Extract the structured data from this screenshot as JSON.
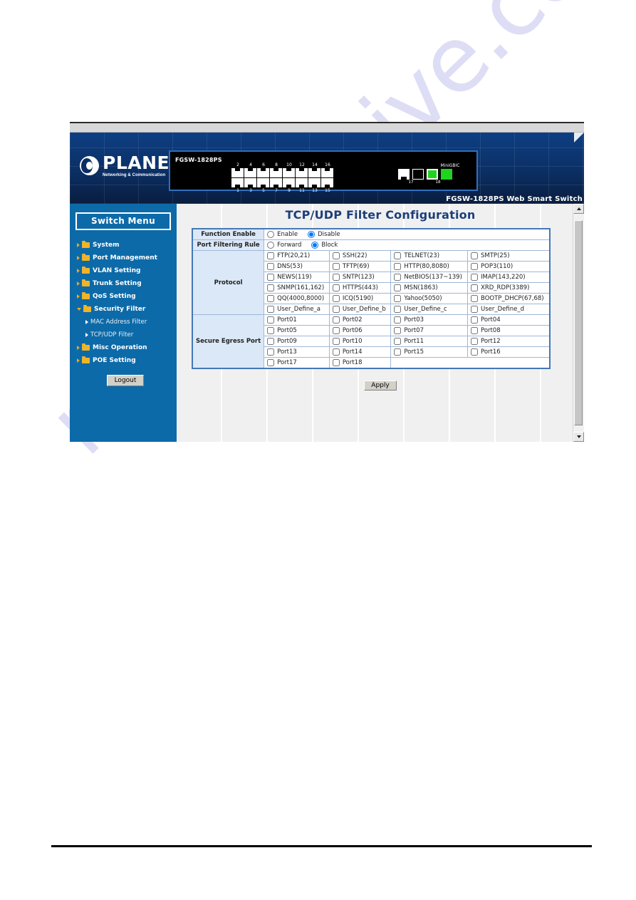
{
  "watermark": {
    "text": "manualshive.com"
  },
  "banner": {
    "brand_name": "PLANET",
    "brand_tagline": "Networking & Communication",
    "device_model": "FGSW-1828PS",
    "device_port_labels_top_group1": [
      "2",
      "4",
      "6",
      "8"
    ],
    "device_port_labels_bottom_group1": [
      "1",
      "3",
      "5",
      "7"
    ],
    "device_port_labels_top_group2": [
      "10",
      "12",
      "14",
      "16"
    ],
    "device_port_labels_bottom_group2": [
      "9",
      "11",
      "13",
      "15"
    ],
    "device_uplink_caption": "MiniGBIC",
    "device_uplink_label_17": "17",
    "device_uplink_label_18": "18",
    "title": "FGSW-1828PS Web Smart Switch"
  },
  "sidebar": {
    "title": "Switch Menu",
    "items": [
      {
        "label": "System",
        "type": "folder",
        "expanded": false
      },
      {
        "label": "Port Management",
        "type": "folder",
        "expanded": false
      },
      {
        "label": "VLAN Setting",
        "type": "folder",
        "expanded": false
      },
      {
        "label": "Trunk Setting",
        "type": "folder",
        "expanded": false
      },
      {
        "label": "QoS Setting",
        "type": "folder",
        "expanded": false
      },
      {
        "label": "Security Filter",
        "type": "folder",
        "expanded": true
      },
      {
        "label": "MAC Address Filter",
        "type": "leaf"
      },
      {
        "label": "TCP/UDP Filter",
        "type": "leaf"
      },
      {
        "label": "Misc Operation",
        "type": "folder",
        "expanded": false
      },
      {
        "label": "POE Setting",
        "type": "folder",
        "expanded": false
      }
    ],
    "logout_label": "Logout",
    "background_color": "#0d6aa8",
    "arrow_color": "#f3a712"
  },
  "main": {
    "page_title": "TCP/UDP Filter Configuration",
    "apply_label": "Apply",
    "rows": {
      "function_enable": {
        "label": "Function Enable",
        "options": [
          "Enable",
          "Disable"
        ],
        "selected": "Disable"
      },
      "port_filtering_rule": {
        "label": "Port Filtering Rule",
        "options": [
          "Forward",
          "Block"
        ],
        "selected": "Block"
      },
      "protocol": {
        "label": "Protocol",
        "grid": [
          [
            "FTP(20,21)",
            "SSH(22)",
            "TELNET(23)",
            "SMTP(25)"
          ],
          [
            "DNS(53)",
            "TFTP(69)",
            "HTTP(80,8080)",
            "POP3(110)"
          ],
          [
            "NEWS(119)",
            "SNTP(123)",
            "NetBIOS(137~139)",
            "IMAP(143,220)"
          ],
          [
            "SNMP(161,162)",
            "HTTPS(443)",
            "MSN(1863)",
            "XRD_RDP(3389)"
          ],
          [
            "QQ(4000,8000)",
            "ICQ(5190)",
            "Yahoo(5050)",
            "BOOTP_DHCP(67,68)"
          ],
          [
            "User_Define_a",
            "User_Define_b",
            "User_Define_c",
            "User_Define_d"
          ]
        ],
        "checked": []
      },
      "secure_egress_port": {
        "label": "Secure Egress Port",
        "grid": [
          [
            "Port01",
            "Port02",
            "Port03",
            "Port04"
          ],
          [
            "Port05",
            "Port06",
            "Port07",
            "Port08"
          ],
          [
            "Port09",
            "Port10",
            "Port11",
            "Port12"
          ],
          [
            "Port13",
            "Port14",
            "Port15",
            "Port16"
          ],
          [
            "Port17",
            "Port18",
            "",
            ""
          ]
        ],
        "checked": []
      }
    }
  },
  "scrollbar": {
    "up_arrow": "scroll-up",
    "down_arrow": "scroll-down"
  },
  "colors": {
    "sidebar_blue": "#0d6aa8",
    "banner_navy": "#0b2f64",
    "table_border": "#4578b5",
    "label_cell_bg": "#dbe8f7",
    "title_blue": "#1d3f7a",
    "accent_orange": "#f3a712",
    "watermark": "#c9caf0"
  }
}
